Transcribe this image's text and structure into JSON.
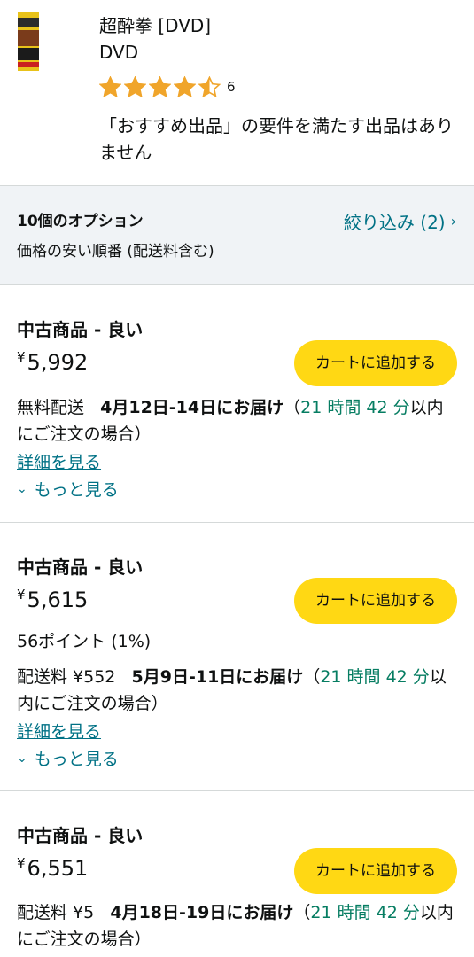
{
  "product": {
    "title": "超酔拳 [DVD]",
    "format": "DVD",
    "rating_value": 4.5,
    "rating_count": "6",
    "no_featured": "「おすすめ出品」の要件を満たす出品はありません",
    "colors": {
      "star": "#f0a52b"
    }
  },
  "options": {
    "count_label": "10個のオプション",
    "sort_label": "価格の安い順番 (配送料含む)",
    "filter_label": "絞り込み (2)",
    "filter_chevron": "›"
  },
  "offers": [
    {
      "condition": "中古商品 - 良い",
      "currency": "¥",
      "price": "5,992",
      "cart_label": "カートに追加する",
      "shipping": "無料配送",
      "delivery": "4月12日-14日にお届け",
      "countdown_open": "（",
      "countdown_time": "21 時間 42 分",
      "countdown_rest": "以内にご注文の場合）",
      "details_link": "詳細を見る",
      "more_link": "もっと見る"
    },
    {
      "condition": "中古商品 - 良い",
      "currency": "¥",
      "price": "5,615",
      "cart_label": "カートに追加する",
      "points": "56ポイント (1%)",
      "shipping": "配送料 ¥552",
      "delivery": "5月9日-11日にお届け",
      "countdown_open": "（",
      "countdown_time": "21 時間 42 分",
      "countdown_rest": "以内にご注文の場合）",
      "details_link": "詳細を見る",
      "more_link": "もっと見る"
    },
    {
      "condition": "中古商品 - 良い",
      "currency": "¥",
      "price": "6,551",
      "cart_label": "カートに追加する",
      "shipping": "配送料 ¥5",
      "delivery": "4月18日-19日にお届け",
      "countdown_open": "（",
      "countdown_time": "21 時間 42 分",
      "countdown_rest": "以内にご注文の場合）"
    }
  ],
  "theme": {
    "button_yellow": "#ffd814",
    "link_teal": "#007185",
    "countdown_green": "#067d62",
    "options_bg": "#f0f3f6"
  }
}
